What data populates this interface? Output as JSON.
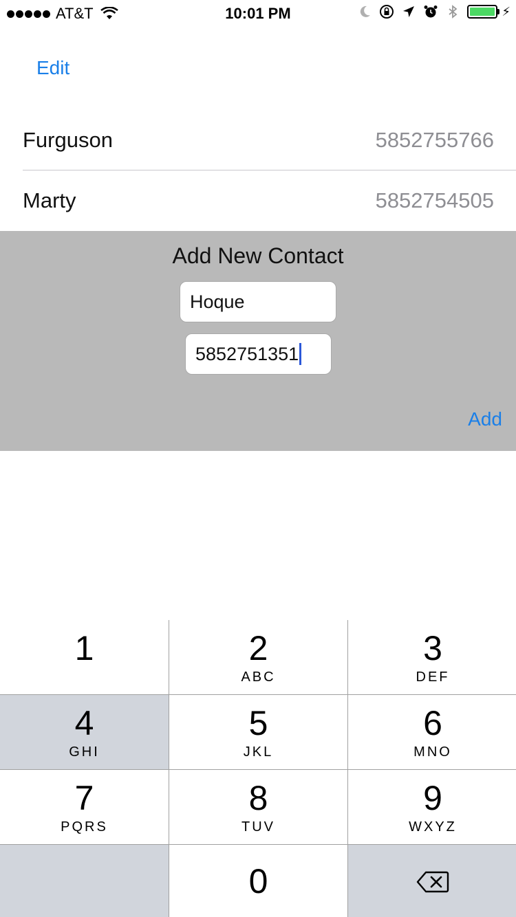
{
  "status_bar": {
    "carrier": "AT&T",
    "time": "10:01 PM",
    "icons": [
      "signal-dots-icon",
      "wifi-icon",
      "moon-icon",
      "rotation-lock-icon",
      "location-arrow-icon",
      "alarm-icon",
      "bluetooth-icon",
      "battery-icon",
      "charging-bolt-icon"
    ],
    "battery_color": "#4cd964"
  },
  "nav": {
    "edit_label": "Edit"
  },
  "contacts": [
    {
      "name": "Furguson",
      "phone": "5852755766"
    },
    {
      "name": "Marty",
      "phone": "5852754505"
    }
  ],
  "add_panel": {
    "title": "Add New Contact",
    "name_value": "Hoque",
    "phone_value": "5852751351",
    "add_label": "Add",
    "background": "#b9b9b9"
  },
  "keypad": {
    "keys": [
      {
        "digit": "1",
        "letters": ""
      },
      {
        "digit": "2",
        "letters": "ABC"
      },
      {
        "digit": "3",
        "letters": "DEF"
      },
      {
        "digit": "4",
        "letters": "GHI"
      },
      {
        "digit": "5",
        "letters": "JKL"
      },
      {
        "digit": "6",
        "letters": "MNO"
      },
      {
        "digit": "7",
        "letters": "PQRS"
      },
      {
        "digit": "8",
        "letters": "TUV"
      },
      {
        "digit": "9",
        "letters": "WXYZ"
      },
      {
        "digit": "0",
        "letters": ""
      }
    ],
    "delete_icon": "delete-backspace-icon"
  },
  "colors": {
    "accent": "#1a7fe8",
    "secondary_text": "#8e8e93",
    "caret": "#2c58d8"
  }
}
